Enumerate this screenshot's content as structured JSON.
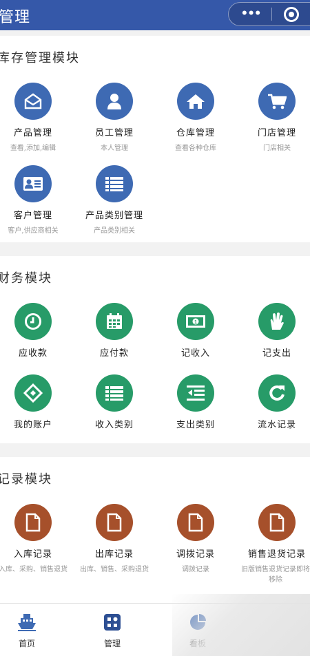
{
  "header": {
    "title": "管理",
    "menu_icon": "more-dots-icon",
    "close_icon": "target-icon"
  },
  "sections": [
    {
      "title": "库存管理模块",
      "items": [
        {
          "label": "产品管理",
          "sub": "查看,添加,编辑",
          "icon": "envelope-icon",
          "color": "#3e6ab3"
        },
        {
          "label": "员工管理",
          "sub": "本人管理",
          "icon": "person-icon",
          "color": "#3e6ab3"
        },
        {
          "label": "仓库管理",
          "sub": "查看各种仓库",
          "icon": "home-icon",
          "color": "#3e6ab3"
        },
        {
          "label": "门店管理",
          "sub": "门店相关",
          "icon": "cart-icon",
          "color": "#3e6ab3"
        },
        {
          "label": "客户管理",
          "sub": "客户,供应商相关",
          "icon": "id-card-icon",
          "color": "#3e6ab3"
        },
        {
          "label": "产品类别管理",
          "sub": "产品类别相关",
          "icon": "list-icon",
          "color": "#3e6ab3"
        }
      ]
    },
    {
      "title": "财务模块",
      "items": [
        {
          "label": "应收款",
          "sub": "",
          "icon": "clock-icon",
          "color": "#279b68"
        },
        {
          "label": "应付款",
          "sub": "",
          "icon": "calendar-icon",
          "color": "#279b68"
        },
        {
          "label": "记收入",
          "sub": "",
          "icon": "money-icon",
          "color": "#279b68"
        },
        {
          "label": "记支出",
          "sub": "",
          "icon": "hand-icon",
          "color": "#279b68"
        },
        {
          "label": "我的账户",
          "sub": "",
          "icon": "diamond-icon",
          "color": "#279b68"
        },
        {
          "label": "收入类别",
          "sub": "",
          "icon": "list-icon",
          "color": "#279b68"
        },
        {
          "label": "支出类别",
          "sub": "",
          "icon": "outdent-icon",
          "color": "#279b68"
        },
        {
          "label": "流水记录",
          "sub": "",
          "icon": "refresh-icon",
          "color": "#279b68"
        }
      ]
    },
    {
      "title": "记录模块",
      "items": [
        {
          "label": "入库记录",
          "sub": "入库、采购、销售退货",
          "icon": "document-icon",
          "color": "#a6502b"
        },
        {
          "label": "出库记录",
          "sub": "出库、销售、采购退货",
          "icon": "document-icon",
          "color": "#a6502b"
        },
        {
          "label": "调拨记录",
          "sub": "调拨记录",
          "icon": "document-icon",
          "color": "#a6502b"
        },
        {
          "label": "销售退货记录",
          "sub": "旧版销售退货记录即将移除",
          "icon": "document-icon",
          "color": "#a6502b"
        }
      ]
    }
  ],
  "tabbar": [
    {
      "label": "首页",
      "icon": "ship-icon"
    },
    {
      "label": "管理",
      "icon": "apps-icon"
    },
    {
      "label": "看板",
      "icon": "pie-chart-icon"
    }
  ]
}
